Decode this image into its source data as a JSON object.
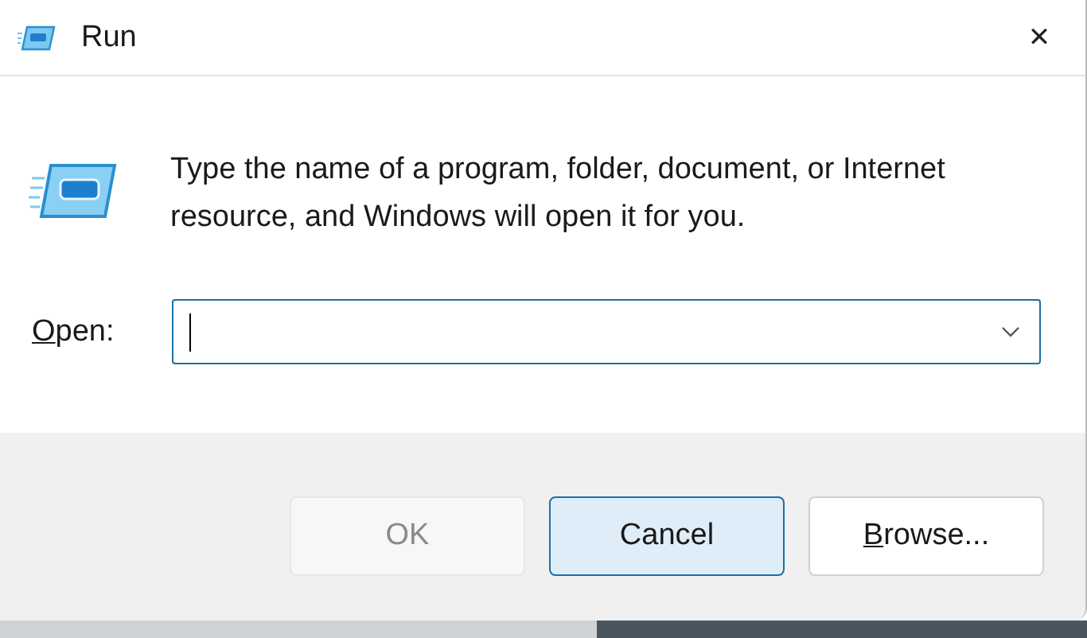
{
  "window": {
    "title": "Run",
    "close": "✕"
  },
  "message": "Type the name of a program, folder, document, or Internet resource, and Windows will open it for you.",
  "open_field": {
    "label": "Open:",
    "label_mnemonic": true,
    "focused": true
  },
  "buttons": [
    {
      "label": "OK",
      "disabled": true,
      "focused": false,
      "mnemonic": false
    },
    {
      "label": "Cancel",
      "disabled": false,
      "focused": true,
      "mnemonic": false
    },
    {
      "label": "Browse...",
      "disabled": false,
      "focused": false,
      "mnemonic": true
    }
  ]
}
